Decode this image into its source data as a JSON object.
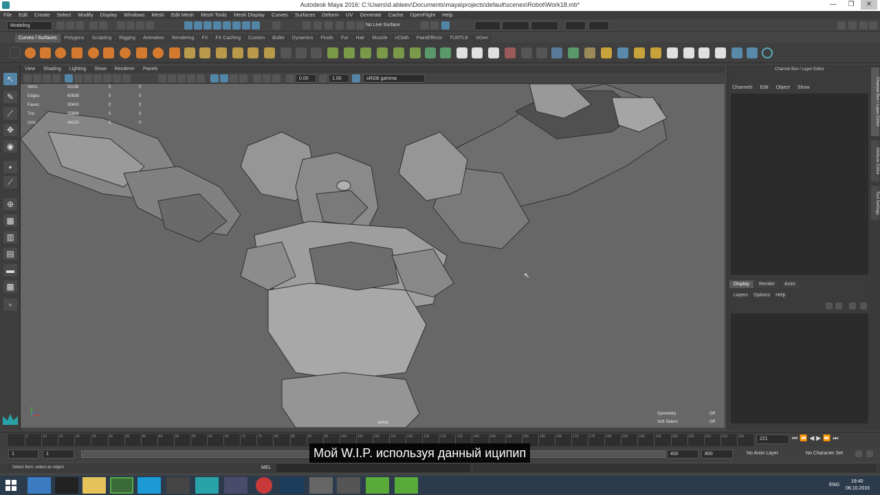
{
  "window": {
    "title": "Autodesk Maya 2016: C:\\Users\\d.ableev\\Documents\\maya\\projects\\default\\scenes\\Robot\\Work18.mb*",
    "minimize": "—",
    "restore": "❐",
    "close": "✕"
  },
  "menubar": [
    "File",
    "Edit",
    "Create",
    "Select",
    "Modify",
    "Display",
    "Windows",
    "Mesh",
    "Edit Mesh",
    "Mesh Tools",
    "Mesh Display",
    "Curves",
    "Surfaces",
    "Deform",
    "UV",
    "Generate",
    "Cache",
    "OpenFlight",
    "Help"
  ],
  "statusline": {
    "mode": "Modeling",
    "no_live_surface": "No Live Surface"
  },
  "shelf_tabs": [
    "Curves / Surfaces",
    "Polygons",
    "Sculpting",
    "Rigging",
    "Animation",
    "Rendering",
    "FX",
    "FX Caching",
    "Custom",
    "Bullet",
    "Dynamics",
    "Fluids",
    "Fur",
    "Hair",
    "Muscle",
    "nCloth",
    "PaintEffects",
    "TURTLE",
    "XGen"
  ],
  "shelf_active": "Curves / Surfaces",
  "panel_menu": [
    "View",
    "Shading",
    "Lighting",
    "Show",
    "Renderer",
    "Panels"
  ],
  "panel_tools": {
    "near": "0.00",
    "far": "1.00",
    "colorspace": "sRGB gamma"
  },
  "hud_stats": [
    {
      "label": "Verts:",
      "a": "31136",
      "b": "0",
      "c": "0"
    },
    {
      "label": "Edges:",
      "a": "60838",
      "b": "0",
      "c": "0"
    },
    {
      "label": "Faces:",
      "a": "30400",
      "b": "0",
      "c": "0"
    },
    {
      "label": "Tris:",
      "a": "55898",
      "b": "0",
      "c": "0"
    },
    {
      "label": "UVs:",
      "a": "44220",
      "b": "0",
      "c": "0"
    }
  ],
  "hud_right": [
    {
      "label": "Symmetry:",
      "value": "Off"
    },
    {
      "label": "Soft Select:",
      "value": "Off"
    }
  ],
  "camera_label": "persp",
  "channel_box": {
    "title": "Channel Box / Layer Editor",
    "menu": [
      "Channels",
      "Edit",
      "Object",
      "Show"
    ]
  },
  "layer_editor": {
    "tabs": [
      "Display",
      "Render",
      "Anim"
    ],
    "active_tab": "Display",
    "menu": [
      "Layers",
      "Options",
      "Help"
    ]
  },
  "side_tabs": [
    "Channel Box / Layer Editor",
    "Attribute Editor",
    "Tool Settings"
  ],
  "timeline": {
    "ticks": [
      "5",
      "10",
      "15",
      "20",
      "25",
      "30",
      "35",
      "40",
      "45",
      "50",
      "55",
      "60",
      "65",
      "70",
      "75",
      "80",
      "85",
      "90",
      "95",
      "100",
      "105",
      "110",
      "115",
      "120",
      "125",
      "130",
      "135",
      "140",
      "145",
      "150",
      "155",
      "160",
      "165",
      "170",
      "175",
      "180",
      "185",
      "190",
      "195",
      "200",
      "205",
      "210",
      "215",
      "220"
    ],
    "current_frame": "221",
    "playback_icons": [
      "⏮",
      "⏪",
      "◀",
      "▶",
      "⏩",
      "⏭"
    ]
  },
  "range": {
    "start": "1",
    "start_inner": "1",
    "end_inner": "400",
    "end": "800",
    "anim_layer": "No Anim Layer",
    "char_set": "No Character Set"
  },
  "cmdline": {
    "help": "Select Item: select an object",
    "lang": "MEL"
  },
  "subtitle": "Мой W.I.P. используя данный иципип",
  "taskbar": {
    "lang": "ENG",
    "time": "19:40",
    "date": "06.10.2015"
  },
  "colors": {
    "accent": "#5285a6",
    "viewport_bg": "#676767",
    "taskbar": "#2c3b4c"
  }
}
